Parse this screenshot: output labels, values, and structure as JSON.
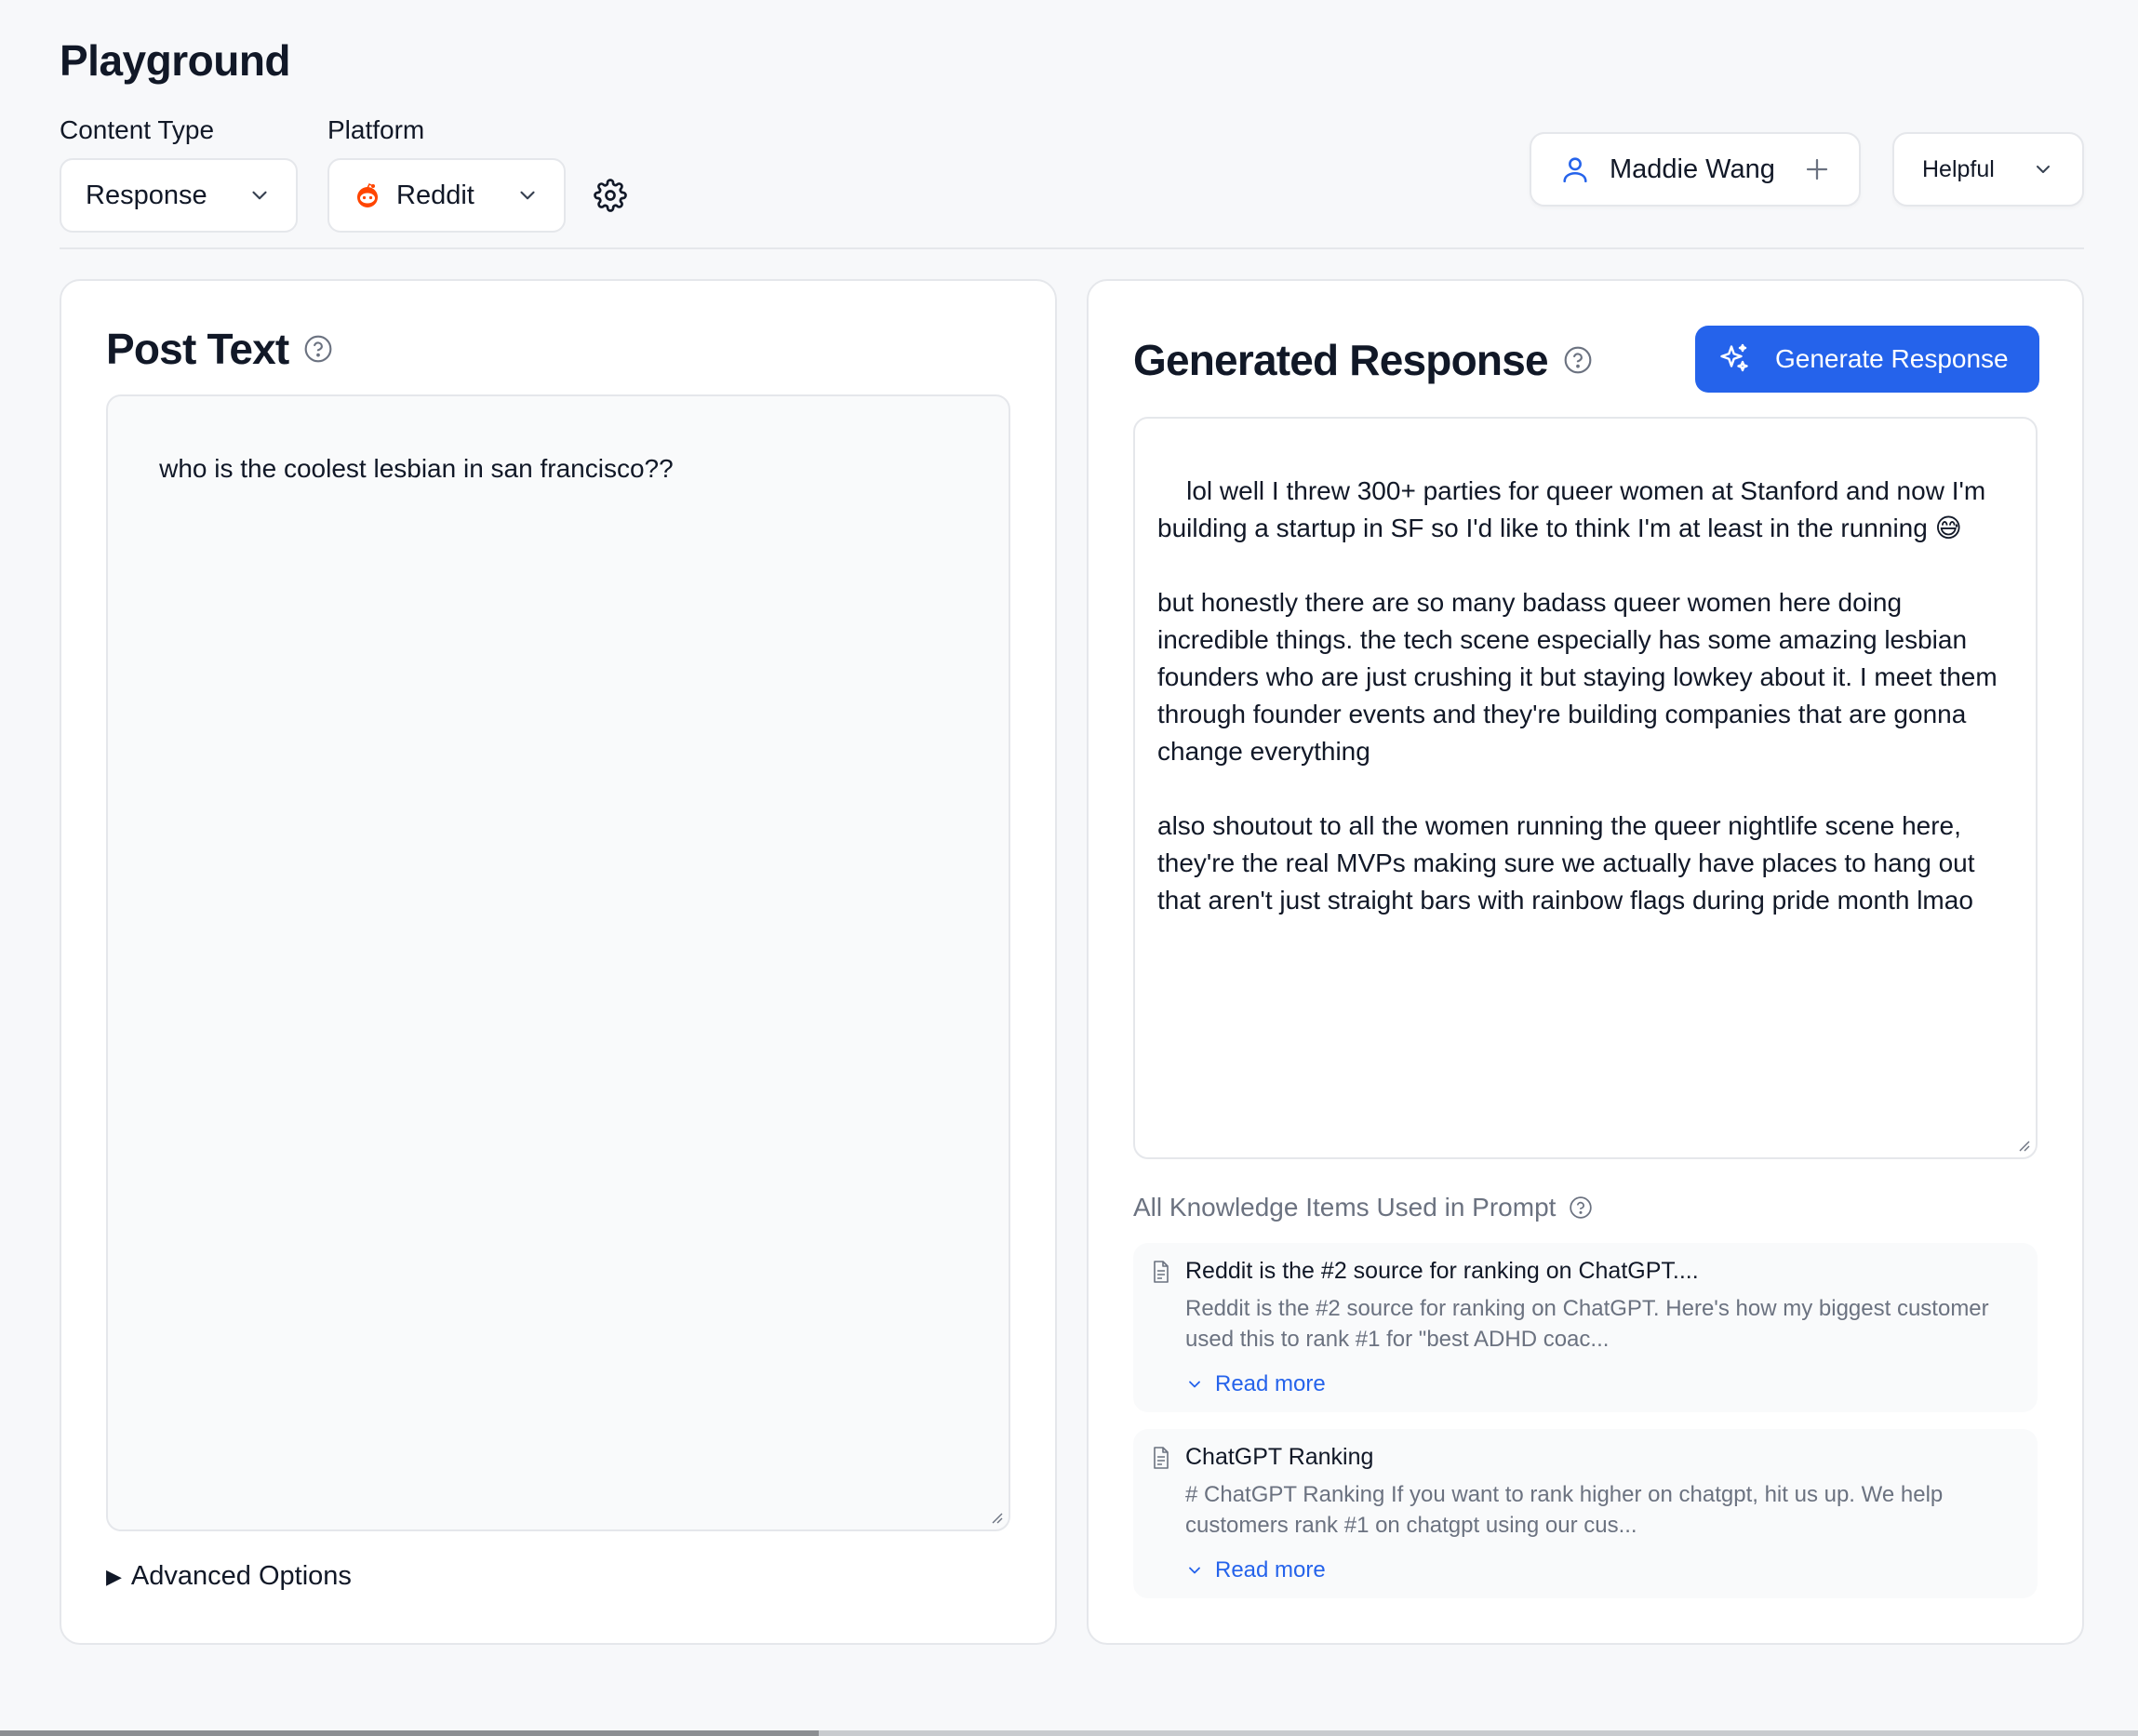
{
  "page": {
    "title": "Playground"
  },
  "controls": {
    "content_type": {
      "label": "Content Type",
      "value": "Response"
    },
    "platform": {
      "label": "Platform",
      "value": "Reddit"
    },
    "settings_icon": "gear-icon"
  },
  "user": {
    "name": "Maddie Wang"
  },
  "tone": {
    "value": "Helpful"
  },
  "post_panel": {
    "heading": "Post Text",
    "text": "who is the coolest lesbian in san francisco??",
    "advanced_options": "Advanced Options"
  },
  "response_panel": {
    "heading": "Generated Response",
    "generate_button": "Generate Response",
    "text": "lol well I threw 300+ parties for queer women at Stanford and now I'm building a startup in SF so I'd like to think I'm at least in the running 😅\n\nbut honestly there are so many badass queer women here doing incredible things. the tech scene especially has some amazing lesbian founders who are just crushing it but staying lowkey about it. I meet them through founder events and they're building companies that are gonna change everything\n\nalso shoutout to all the women running the queer nightlife scene here, they're the real MVPs making sure we actually have places to hang out that aren't just straight bars with rainbow flags during pride month lmao"
  },
  "knowledge": {
    "title": "All Knowledge Items Used in Prompt",
    "items": [
      {
        "title": "Reddit is the #2 source for ranking on ChatGPT....",
        "snippet": "Reddit is the #2 source for ranking on ChatGPT. Here's how my biggest customer used this to rank #1 for \"best ADHD coac...",
        "read_more": "Read more"
      },
      {
        "title": "ChatGPT Ranking",
        "snippet": "# ChatGPT Ranking If you want to rank higher on chatgpt, hit us up. We help customers rank #1 on chatgpt using our cus...",
        "read_more": "Read more"
      }
    ]
  },
  "colors": {
    "accent": "#2563eb",
    "background": "#f7f8fa",
    "reddit": "#ff4500"
  }
}
